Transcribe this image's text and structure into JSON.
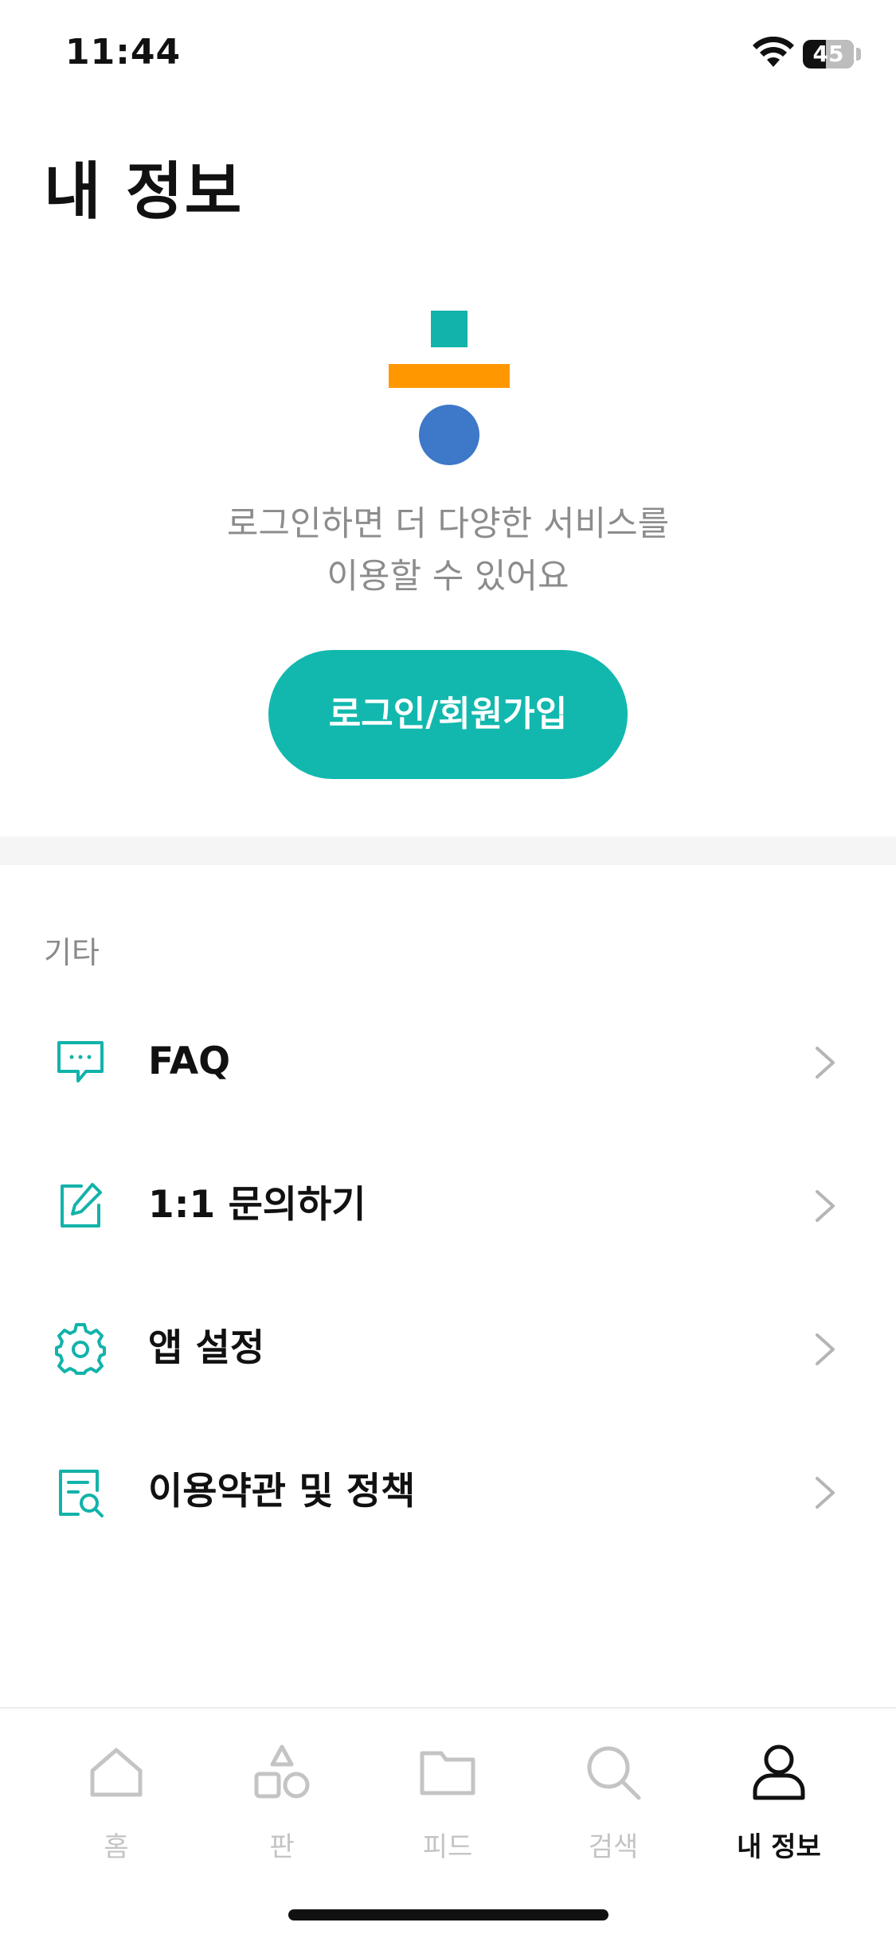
{
  "status_bar": {
    "time": "11:44",
    "battery": "45",
    "battery_level": 0.45
  },
  "header": {
    "title": "내 정보"
  },
  "login_prompt": {
    "line1": "로그인하면 더 다양한 서비스를",
    "line2": "이용할 수 있어요",
    "button_label": "로그인/회원가입"
  },
  "section": {
    "label": "기타"
  },
  "menu": {
    "items": [
      {
        "label": "FAQ",
        "icon": "chat-bubble-icon"
      },
      {
        "label": "1:1 문의하기",
        "icon": "edit-icon"
      },
      {
        "label": "앱 설정",
        "icon": "gear-icon"
      },
      {
        "label": "이용약관 및 정책",
        "icon": "document-search-icon"
      }
    ]
  },
  "tab_bar": {
    "tabs": [
      {
        "label": "홈",
        "icon": "home-icon",
        "active": false
      },
      {
        "label": "판",
        "icon": "shapes-icon",
        "active": false
      },
      {
        "label": "피드",
        "icon": "folder-icon",
        "active": false
      },
      {
        "label": "검색",
        "icon": "search-icon",
        "active": false
      },
      {
        "label": "내 정보",
        "icon": "user-icon",
        "active": true
      }
    ]
  },
  "colors": {
    "accent": "#12B8AE",
    "logo_orange": "#FF9800",
    "logo_blue": "#3D78C9",
    "inactive_tab": "#C4C4C4"
  }
}
